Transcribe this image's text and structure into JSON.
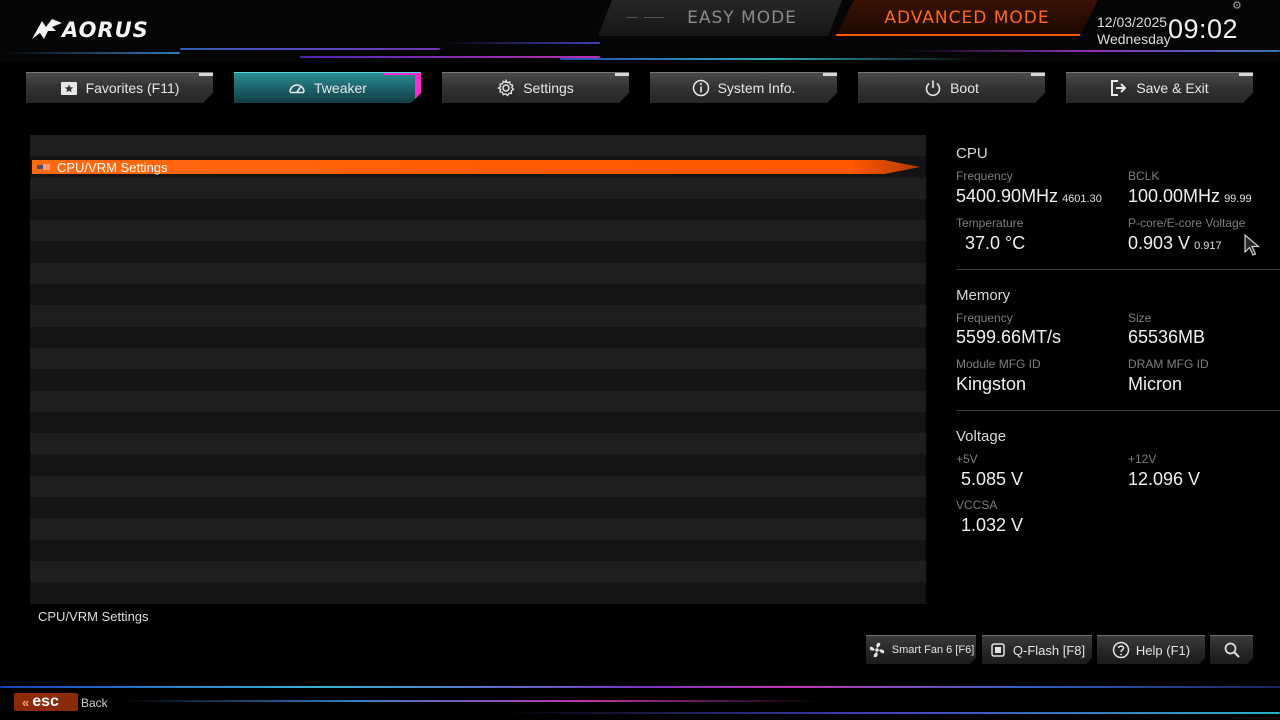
{
  "brand": {
    "logo_text": "AORUS",
    "logo_icon": "aorus-eagle-icon"
  },
  "modes": {
    "easy_label": "EASY MODE",
    "advanced_label": "ADVANCED MODE",
    "active": "advanced",
    "accent": "#ff6a1a"
  },
  "datetime": {
    "date": "12/03/2025",
    "weekday": "Wednesday",
    "time": "09:02"
  },
  "tabs": [
    {
      "label": "Favorites (F11)",
      "icon": "star-box-icon",
      "active": false
    },
    {
      "label": "Tweaker",
      "icon": "speedometer-icon",
      "active": true
    },
    {
      "label": "Settings",
      "icon": "gear-icon",
      "active": false
    },
    {
      "label": "System Info.",
      "icon": "info-icon",
      "active": false
    },
    {
      "label": "Boot",
      "icon": "power-icon",
      "active": false
    },
    {
      "label": "Save & Exit",
      "icon": "exit-icon",
      "active": false
    }
  ],
  "menu": {
    "items": [
      {
        "label": "CPU/VRM Settings",
        "selected": true
      }
    ],
    "help_text": "CPU/VRM Settings"
  },
  "info": {
    "cpu": {
      "title": "CPU",
      "frequency_label": "Frequency",
      "frequency_value": "5400.90MHz",
      "frequency_sub": "4601.30",
      "bclk_label": "BCLK",
      "bclk_value": "100.00MHz",
      "bclk_sub": "99.99",
      "temperature_label": "Temperature",
      "temperature_value": "37.0 °C",
      "voltage_label": "P-core/E-core Voltage",
      "voltage_value": "0.903 V",
      "voltage_sub": "0.917"
    },
    "memory": {
      "title": "Memory",
      "frequency_label": "Frequency",
      "frequency_value": "5599.66MT/s",
      "size_label": "Size",
      "size_value": "65536MB",
      "module_label": "Module MFG ID",
      "module_value": "Kingston",
      "dram_label": "DRAM MFG ID",
      "dram_value": "Micron"
    },
    "voltage": {
      "title": "Voltage",
      "v5_label": "+5V",
      "v5_value": "5.085 V",
      "v12_label": "+12V",
      "v12_value": "12.096 V",
      "vccsa_label": "VCCSA",
      "vccsa_value": "1.032 V"
    }
  },
  "bottom": {
    "smartfan_label": "Smart Fan 6 [F6]",
    "qflash_label": "Q-Flash [F8]",
    "help_label": "Help (F1)",
    "search_icon": "search-icon",
    "esc_label": "esc",
    "back_label": "Back"
  }
}
